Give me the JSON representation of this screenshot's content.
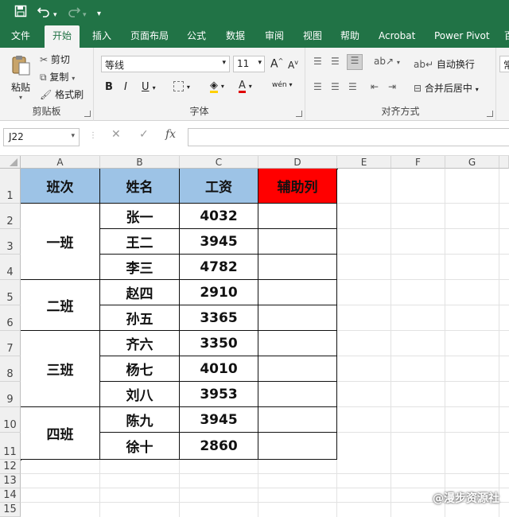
{
  "qat": {
    "save_icon": "save-icon",
    "undo_icon": "undo-icon",
    "redo_icon": "redo-icon",
    "customize_icon": "customize-icon"
  },
  "tabs": [
    "文件",
    "开始",
    "插入",
    "页面布局",
    "公式",
    "数据",
    "审阅",
    "视图",
    "帮助",
    "Acrobat",
    "Power Pivot",
    "百"
  ],
  "active_tab": "开始",
  "ribbon": {
    "clipboard": {
      "paste": "粘贴",
      "cut": "剪切",
      "copy": "复制",
      "format_painter": "格式刷",
      "label": "剪贴板"
    },
    "font": {
      "name": "等线",
      "size": "11",
      "bold": "B",
      "italic": "I",
      "underline": "U",
      "label": "字体",
      "grow": "A",
      "shrink": "A",
      "phonetic": "wén"
    },
    "alignment": {
      "wrap": "自动换行",
      "merge": "合并后居中",
      "label": "对齐方式"
    },
    "number": {
      "format": "常"
    }
  },
  "formula_bar": {
    "name_box": "J22",
    "cancel": "✕",
    "enter": "✓",
    "fx": "fx",
    "value": ""
  },
  "columns": [
    "A",
    "B",
    "C",
    "D",
    "E",
    "F",
    "G"
  ],
  "rows": [
    "1",
    "2",
    "3",
    "4",
    "5",
    "6",
    "7",
    "8",
    "9",
    "10",
    "11",
    "12",
    "13",
    "14",
    "15"
  ],
  "table": {
    "headers": [
      "班次",
      "姓名",
      "工资",
      "辅助列"
    ],
    "classes": [
      "一班",
      "二班",
      "三班",
      "四班"
    ],
    "names": [
      "张一",
      "王二",
      "李三",
      "赵四",
      "孙五",
      "齐六",
      "杨七",
      "刘八",
      "陈九",
      "徐十"
    ],
    "salaries": [
      "4032",
      "3945",
      "4782",
      "2910",
      "3365",
      "3350",
      "4010",
      "3953",
      "3945",
      "2860"
    ]
  },
  "colors": {
    "excel_green": "#217346",
    "header_fill": "#9dc3e6",
    "helper_fill": "#ff0000"
  },
  "watermark": "@漫步资源社"
}
